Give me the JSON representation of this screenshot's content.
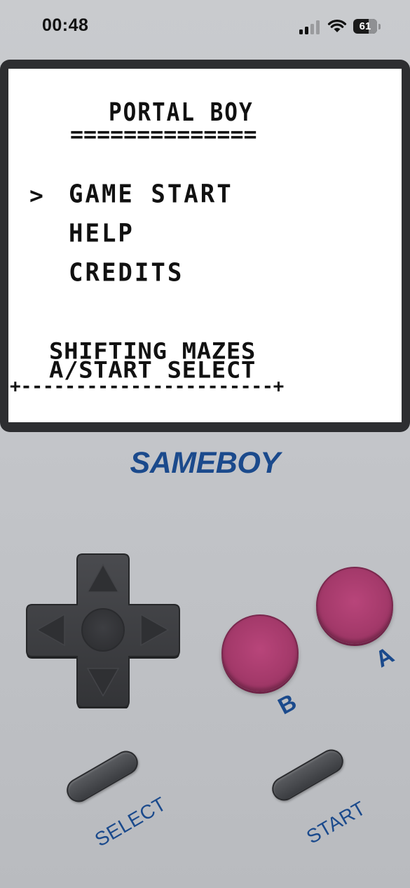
{
  "status_bar": {
    "time": "00:48",
    "battery_level": "61",
    "icons": [
      "signal-icon",
      "wifi-icon",
      "battery-icon"
    ]
  },
  "screen": {
    "title": "PORTAL BOY",
    "title_underline": "==============",
    "cursor": ">",
    "menu": [
      {
        "label": "GAME START"
      },
      {
        "label": "HELP"
      },
      {
        "label": "CREDITS"
      }
    ],
    "footer_line1": "SHIFTING MAZES",
    "footer_line2": "A/START SELECT",
    "bottom_border": "+-----------------------+"
  },
  "brand": {
    "name": "SAMEBOY"
  },
  "controls": {
    "b_label": "B",
    "a_label": "A",
    "select_label": "SELECT",
    "start_label": "START",
    "dpad_icons": [
      "arrow-up-icon",
      "arrow-down-icon",
      "arrow-left-icon",
      "arrow-right-icon"
    ]
  },
  "colors": {
    "accent_blue": "#1b4a8c",
    "button_magenta": "#a53a6b",
    "dpad_dark": "#3a3b3e",
    "body_gray": "#c5c7cb"
  }
}
